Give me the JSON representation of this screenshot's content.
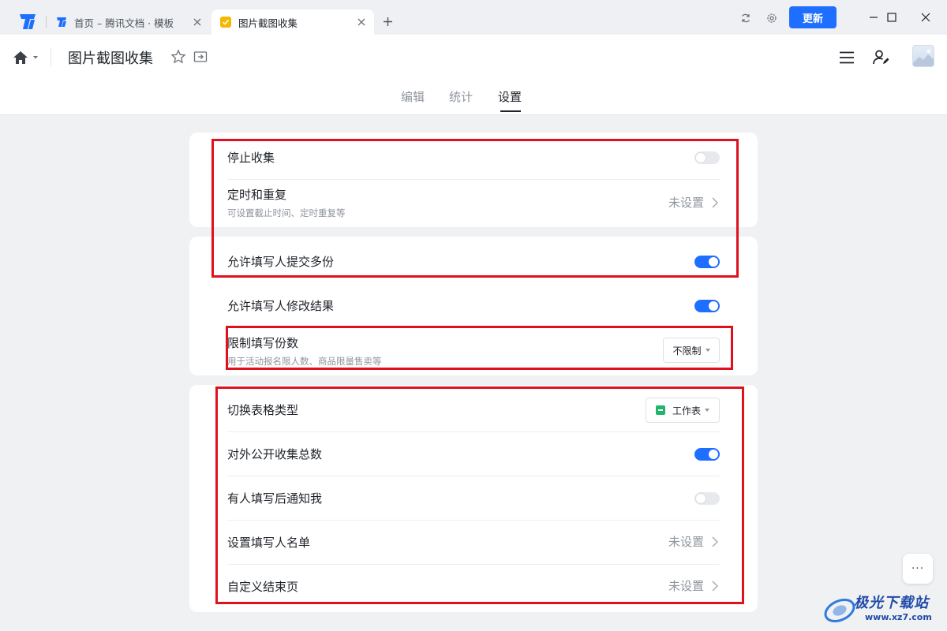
{
  "browser": {
    "tabs": [
      {
        "label": "首页 – 腾讯文档 · 模板",
        "active": false
      },
      {
        "label": "图片截图收集",
        "active": true
      }
    ],
    "update_label": "更新"
  },
  "header": {
    "doc_title": "图片截图收集",
    "view_tabs": [
      "编辑",
      "统计",
      "设置"
    ],
    "active_view_tab": "设置"
  },
  "settings": {
    "card1": {
      "stop_collect": {
        "title": "停止收集",
        "enabled": false
      },
      "timing": {
        "title": "定时和重复",
        "subtitle": "可设置截止时间、定时重复等",
        "value": "未设置"
      }
    },
    "card2": {
      "multi_submit": {
        "title": "允许填写人提交多份",
        "enabled": true
      },
      "modify_result": {
        "title": "允许填写人修改结果",
        "enabled": true
      },
      "limit_count": {
        "title": "限制填写份数",
        "subtitle": "用于活动报名限人数、商品限量售卖等",
        "value": "不限制"
      }
    },
    "card3": {
      "table_type": {
        "title": "切换表格类型",
        "value": "工作表"
      },
      "public_total": {
        "title": "对外公开收集总数",
        "enabled": true
      },
      "notify_me": {
        "title": "有人填写后通知我",
        "enabled": false
      },
      "filler_list": {
        "title": "设置填写人名单",
        "value": "未设置"
      },
      "end_page": {
        "title": "自定义结束页",
        "value": "未设置"
      }
    }
  },
  "more_label": "···",
  "watermark": {
    "text": "极光下载站",
    "url": "www.xz7.com"
  },
  "colors": {
    "accent": "#1e6fff",
    "highlight": "#e0101e",
    "sheet_green": "#21b46b"
  }
}
